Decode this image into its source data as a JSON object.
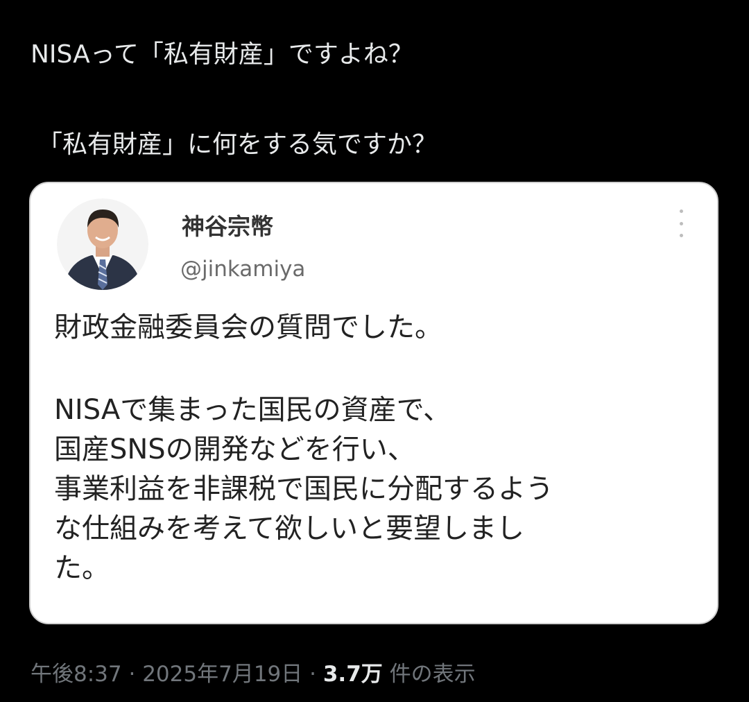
{
  "tweet": {
    "text_line1": "NISAって「私有財産」ですよね？",
    "text_line2": "「私有財産」に何をする気ですか？"
  },
  "quote": {
    "author_name": "神谷宗幣",
    "author_handle": "@jinkamiya",
    "body_line1": "財政金融委員会の質問でした。",
    "body_line2": "NISAで集まった国民の資産で、",
    "body_line3": "国産SNSの開発などを行い、",
    "body_line4": "事業利益を非課税で国民に分配するよう",
    "body_line5": "な仕組みを考えて欲しいと要望しまし",
    "body_line6": "た。",
    "more_icon": "more-vertical-icon"
  },
  "meta": {
    "time": "午後8:37",
    "separator1": "·",
    "date": "2025年7月19日",
    "separator2": "·",
    "views_count": "3.7万",
    "views_label": "件の表示"
  },
  "colors": {
    "background": "#000000",
    "text": "#e7e9ea",
    "meta": "#71767b",
    "card": "#ffffff"
  }
}
